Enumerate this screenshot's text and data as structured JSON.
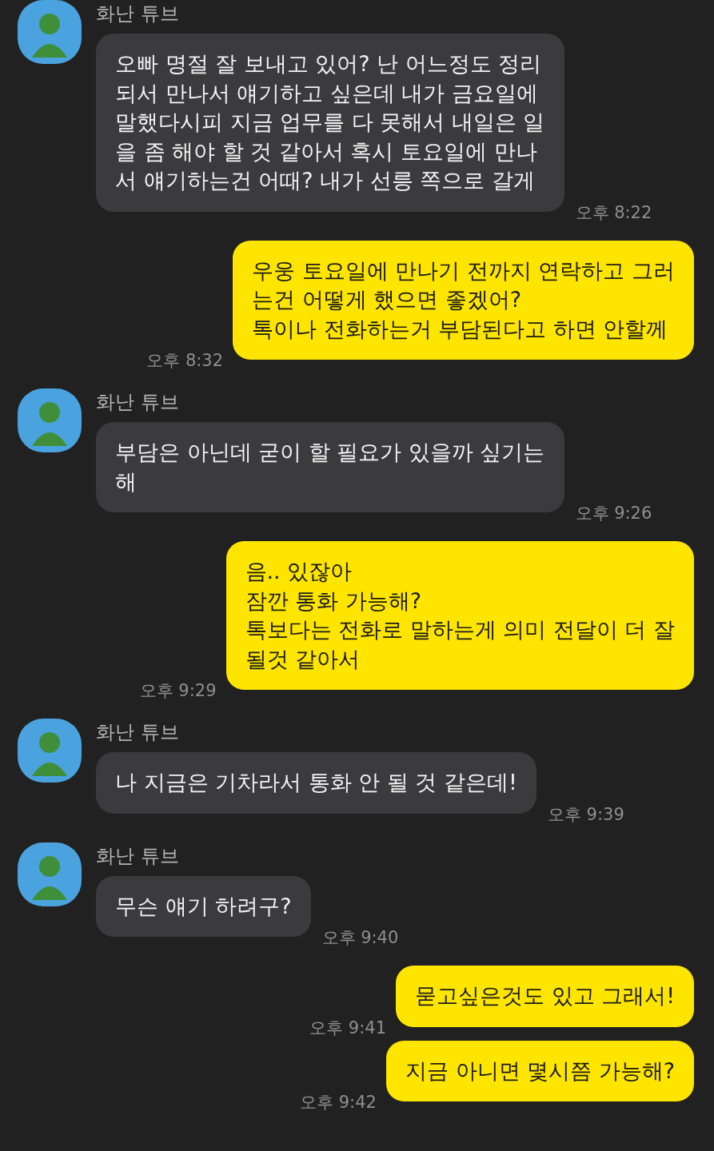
{
  "messages": [
    {
      "kind": "incoming",
      "sender": "화난 튜브",
      "text": "오빠 명절 잘 보내고 있어? 난 어느정도 정리\n되서 만나서 얘기하고 싶은데 내가 금요일에\n말했다시피 지금 업무를 다 못해서 내일은 일\n을 좀 해야 할 것 같아서 혹시 토요일에 만나\n서 얘기하는건 어때? 내가 선릉 쪽으로 갈게",
      "time": "오후 8:22"
    },
    {
      "kind": "outgoing",
      "text": "우웅 토요일에 만나기 전까지 연락하고 그러\n는건 어떻게 했으면 좋겠어?\n톡이나 전화하는거 부담된다고 하면 안할께",
      "time": "오후 8:32"
    },
    {
      "kind": "incoming",
      "sender": "화난 튜브",
      "text": "부담은 아닌데 굳이 할 필요가 있을까 싶기는\n해",
      "time": "오후 9:26"
    },
    {
      "kind": "outgoing",
      "text": "음.. 있잖아\n잠깐 통화 가능해?\n톡보다는 전화로 말하는게 의미 전달이 더 잘\n될것 같아서",
      "time": "오후 9:29"
    },
    {
      "kind": "incoming",
      "sender": "화난 튜브",
      "text": "나 지금은 기차라서 통화 안 될 것 같은데!",
      "time": "오후 9:39"
    },
    {
      "kind": "incoming",
      "sender": "화난 튜브",
      "text": "무슨 얘기 하려구?",
      "time": "오후 9:40"
    },
    {
      "kind": "outgoing",
      "text": "묻고싶은것도 있고 그래서!",
      "time": "오후 9:41"
    },
    {
      "kind": "outgoing",
      "text": "지금 아니면 몇시쯤 가능해?",
      "time": "오후 9:42"
    }
  ]
}
